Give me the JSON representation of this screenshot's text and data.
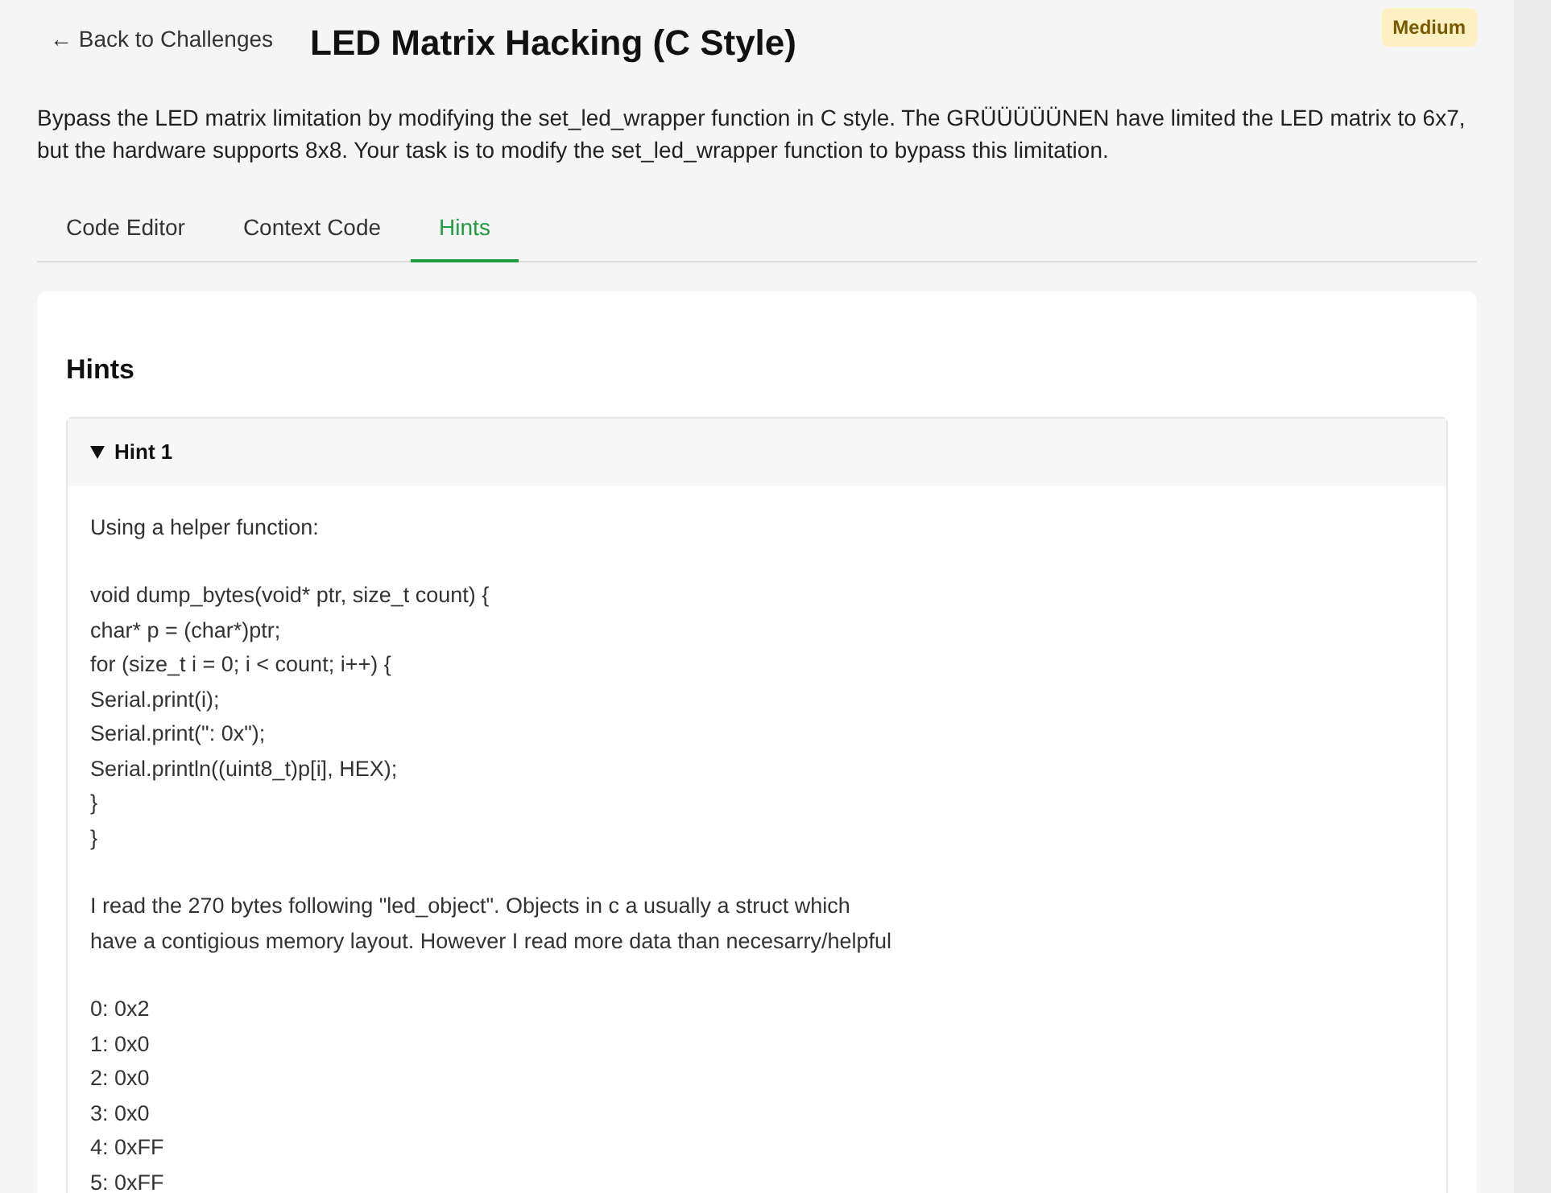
{
  "header": {
    "back_link": "← Back to Challenges",
    "title": "LED Matrix Hacking (C Style)",
    "difficulty": "Medium"
  },
  "description": "Bypass the LED matrix limitation by modifying the set_led_wrapper function in C style. The GRÜÜÜÜÜNEN have limited the LED matrix to 6x7, but the hardware supports 8x8. Your task is to modify the set_led_wrapper function to bypass this limitation.",
  "tabs": [
    {
      "label": "Code Editor",
      "selected": false
    },
    {
      "label": "Context Code",
      "selected": false
    },
    {
      "label": "Hints",
      "selected": true
    }
  ],
  "hints_panel": {
    "title": "Hints",
    "hints": [
      {
        "title": "Hint 1",
        "expanded": true,
        "blocks": [
          [
            "Using a helper function:"
          ],
          [
            "void dump_bytes(void* ptr, size_t count) {",
            "char* p = (char*)ptr;",
            "for (size_t i = 0; i < count; i++) {",
            "Serial.print(i);",
            "Serial.print(\": 0x\");",
            "Serial.println((uint8_t)p[i], HEX);",
            "}",
            "}"
          ],
          [
            "I read the 270 bytes following \"led_object\". Objects in c a usually a struct which",
            "have a contigious memory layout. However I read more data than necesarry/helpful"
          ],
          [
            "0: 0x2",
            "1: 0x0",
            "2: 0x0",
            "3: 0x0",
            "4: 0xFF",
            "5: 0xFF"
          ]
        ]
      }
    ]
  }
}
